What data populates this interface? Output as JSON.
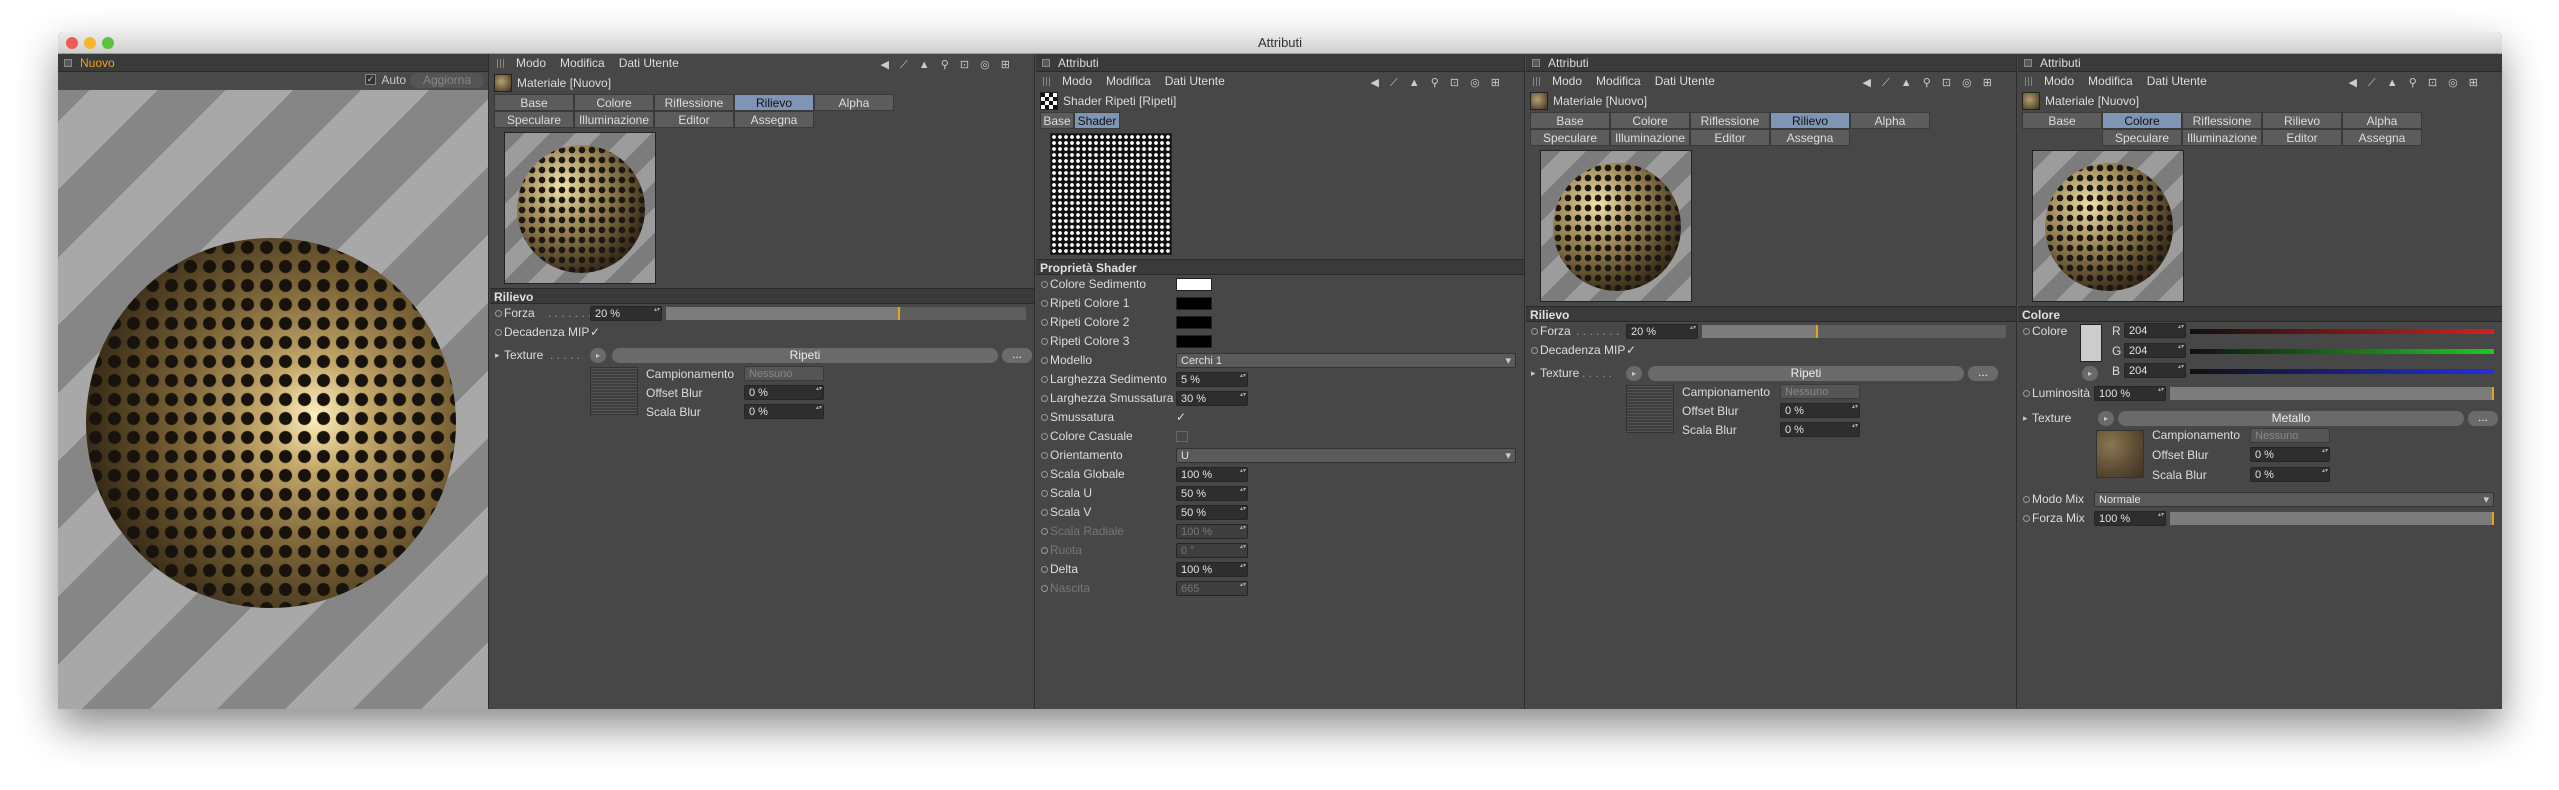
{
  "window": {
    "title": "Attributi"
  },
  "viewport": {
    "tab_label": "Nuovo",
    "auto_label": "Auto",
    "refresh_label": "Aggiorna"
  },
  "menu": {
    "modo": "Modo",
    "modifica": "Modifica",
    "dati_utente": "Dati Utente"
  },
  "panels_title": "Attributi",
  "material_name": "Materiale [Nuovo]",
  "tabs_row1": [
    "Base",
    "Colore",
    "Riflessione",
    "Rilievo",
    "Alpha",
    "Speculare"
  ],
  "tabs_row1b": [
    "Illuminazione",
    "Editor",
    "Assegna"
  ],
  "tabs_p4_row1": [
    "Base",
    "Colore",
    "Riflessione",
    "Rilievo",
    "Alpha"
  ],
  "tabs_p4_row2": [
    "Speculare",
    "Illuminazione",
    "Editor",
    "Assegna"
  ],
  "rilievo": {
    "section": "Rilievo",
    "forza_label": "Forza",
    "forza_value": "20 %",
    "forza_fraction": 0.65,
    "decadenza_label": "Decadenza MIP",
    "texture_label": "Texture",
    "texture_value": "Ripeti",
    "more_label": "...",
    "campionamento_label": "Campionamento",
    "campionamento_value": "Nessuno",
    "offset_label": "Offset Blur",
    "offset_value": "0 %",
    "scala_label": "Scala Blur",
    "scala_value": "0 %"
  },
  "shader": {
    "title": "Shader Ripeti [Ripeti]",
    "tab_base": "Base",
    "tab_shader": "Shader",
    "section": "Proprietà Shader",
    "rows": [
      {
        "label": "Colore Sedimento",
        "type": "color",
        "color": "#ffffff"
      },
      {
        "label": "Ripeti Colore 1",
        "type": "color",
        "color": "#000000"
      },
      {
        "label": "Ripeti Colore 2",
        "type": "color",
        "color": "#000000"
      },
      {
        "label": "Ripeti Colore 3",
        "type": "color",
        "color": "#000000"
      },
      {
        "label": "Modello",
        "type": "dropdown",
        "value": "Cerchi 1"
      },
      {
        "label": "Larghezza Sedimento",
        "type": "field",
        "value": "5 %"
      },
      {
        "label": "Larghezza Smussatura",
        "type": "field",
        "value": "30 %"
      },
      {
        "label": "Smussatura",
        "type": "check",
        "value": "✓"
      },
      {
        "label": "Colore Casuale",
        "type": "check",
        "value": ""
      },
      {
        "label": "Orientamento",
        "type": "dropdown",
        "value": "U"
      },
      {
        "label": "Scala Globale",
        "type": "field",
        "value": "100 %"
      },
      {
        "label": "Scala U",
        "type": "field",
        "value": "50 %"
      },
      {
        "label": "Scala V",
        "type": "field",
        "value": "50 %"
      },
      {
        "label": "Scala Radiale",
        "type": "field",
        "value": "100 %",
        "disabled": true
      },
      {
        "label": "Ruota",
        "type": "field",
        "value": "0 °",
        "disabled": true
      },
      {
        "label": "Delta",
        "type": "field",
        "value": "100 %"
      },
      {
        "label": "Nascita",
        "type": "field",
        "value": "665",
        "disabled": true
      }
    ]
  },
  "colore": {
    "section": "Colore",
    "label": "Colore",
    "r_label": "R",
    "g_label": "G",
    "b_label": "B",
    "r": "204",
    "g": "204",
    "b": "204",
    "swatch": "#cccccc",
    "lum_label": "Luminosità",
    "lum_value": "100 %",
    "texture_label": "Texture",
    "texture_value": "Metallo",
    "campionamento_label": "Campionamento",
    "campionamento_value": "Nessuno",
    "offset_label": "Offset Blur",
    "offset_value": "0 %",
    "scala_label": "Scala Blur",
    "scala_value": "0 %",
    "modo_label": "Modo Mix",
    "modo_value": "Normale",
    "forza_label": "Forza Mix",
    "forza_value": "100 %"
  }
}
